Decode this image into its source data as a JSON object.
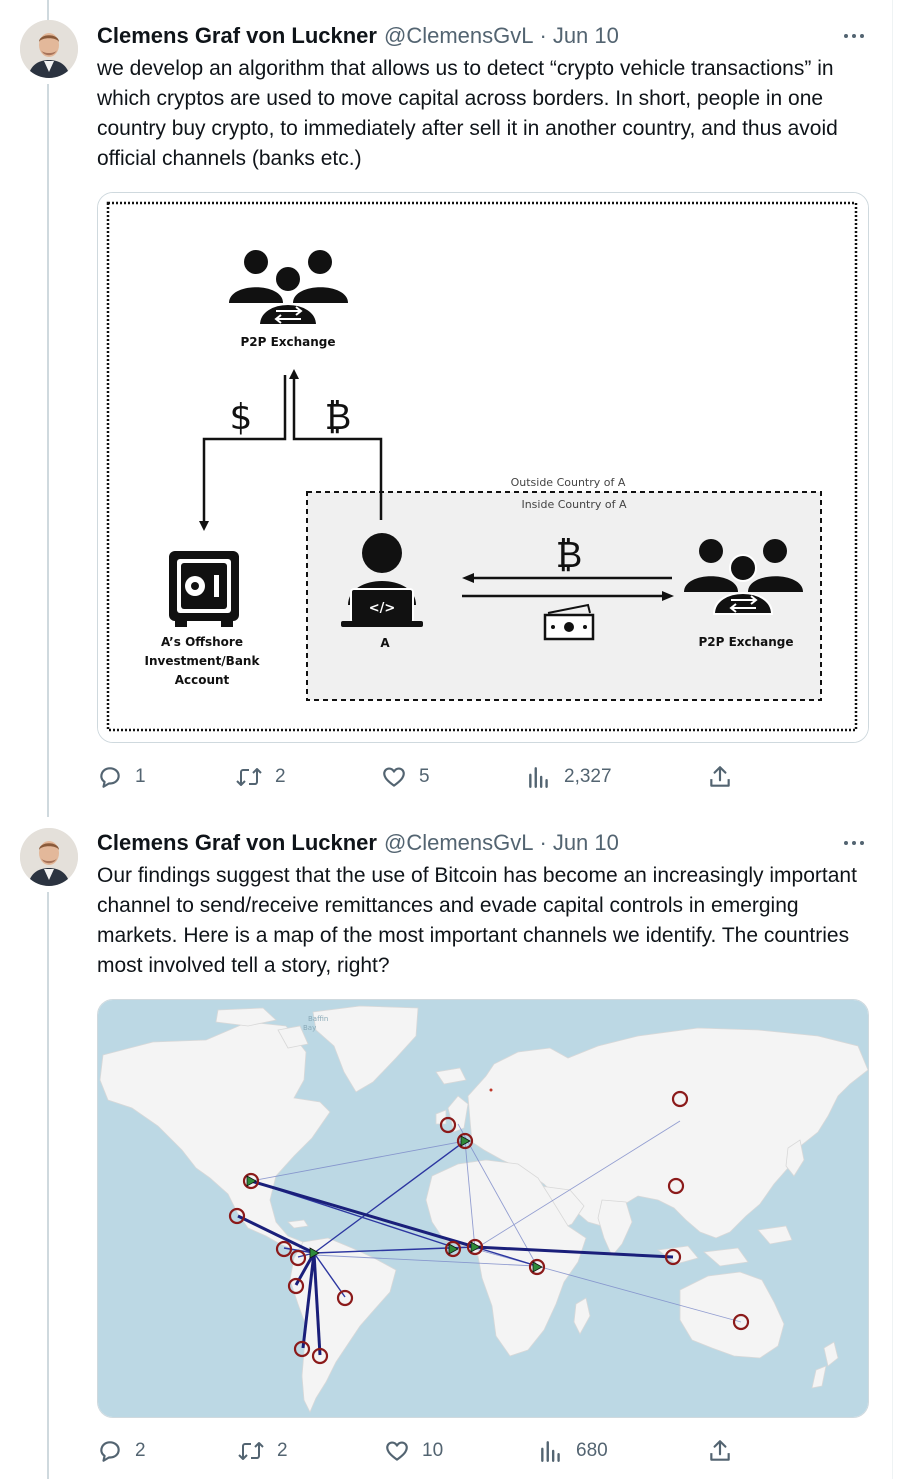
{
  "tweets": [
    {
      "author_name": "Clemens Graf von Luckner",
      "handle": "@ClemensGvL",
      "separator": "·",
      "date": "Jun 10",
      "text": "we develop an algorithm that allows us to detect “crypto vehicle transactions” in which cryptos are used to move capital across borders. In short, people in one country buy crypto, to immediately after sell it in another country, and thus avoid official channels (banks etc.)",
      "media": {
        "type": "diagram",
        "labels": {
          "p2p_top": "P2P Exchange",
          "dollar": "$",
          "bitcoin_top": "₿",
          "outside": "Outside Country of A",
          "inside": "Inside Country of A",
          "bitcoin_mid": "₿",
          "offshore_line1": "A’s Offshore",
          "offshore_line2": "Investment/Bank",
          "offshore_line3": "Account",
          "person_a": "A",
          "p2p_right": "P2P Exchange",
          "code": "</>"
        }
      },
      "actions": {
        "replies": "1",
        "retweets": "2",
        "likes": "5",
        "views": "2,327"
      }
    },
    {
      "author_name": "Clemens Graf von Luckner",
      "handle": "@ClemensGvL",
      "separator": "·",
      "date": "Jun 10",
      "text": "Our findings suggest that the use of Bitcoin has become an increasingly important channel to send/receive remittances and evade capital controls in emerging markets. Here is a map of the most important channels we identify. The countries most involved tell a story, right?",
      "media": {
        "type": "map",
        "labels": {
          "baffin": "Baffin",
          "bay": "Bay"
        },
        "colors": {
          "ocean": "#bcd8e4",
          "land": "#f4f4f4",
          "node_ring": "#8b1a1a",
          "node_fill": "#2e8b3a",
          "link": "#1f2a8c"
        }
      },
      "actions": {
        "replies": "2",
        "retweets": "2",
        "likes": "10",
        "views": "680"
      }
    }
  ],
  "icons": {
    "more": "more-horizontal-icon",
    "reply": "reply-bubble-icon",
    "retweet": "retweet-icon",
    "like": "heart-icon",
    "views": "bar-chart-icon",
    "share": "share-upload-icon"
  }
}
